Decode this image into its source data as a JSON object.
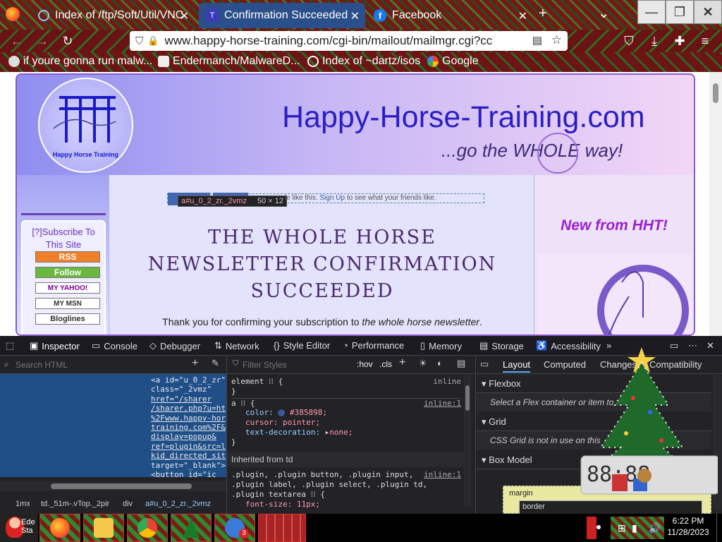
{
  "browser": {
    "tabs": [
      {
        "label": "Index of /ftp/Soft/Util/VNC",
        "close": "✕"
      },
      {
        "label": "Confirmation Succeeded",
        "close": "✕"
      },
      {
        "label": "Facebook",
        "close": "✕"
      }
    ],
    "new_tab": "+",
    "tab_list": "⌄",
    "window": {
      "minimize": "—",
      "restore": "❐",
      "close": "✕"
    },
    "url": "www.happy-horse-training.com/cgi-bin/mailout/mailmgr.cgi?cc",
    "bookmarks": [
      {
        "label": "if youre gonna run malw..."
      },
      {
        "label": "Endermanch/MalwareD..."
      },
      {
        "label": "Index of ~dartz/isos"
      },
      {
        "label": "Google"
      }
    ]
  },
  "site": {
    "title": "Happy-Horse-Training.com",
    "tagline": "...go the WHOLE way!",
    "logo_text": "Happy Horse Training",
    "subscribe_label": "[?]Subscribe To This Site",
    "feeds": [
      "RSS",
      "Follow",
      "MY YAHOO!",
      "MY MSN",
      "Bloglines"
    ],
    "fb_tooltip": {
      "selector": "a#u_0_2_zr._2vmz",
      "size": "50 × 12"
    },
    "fb_text": "le like this.",
    "fb_signup": "Sign Up",
    "fb_tail": "to see what your friends like.",
    "heading": "THE WHOLE HORSE NEWSLETTER CONFIRMATION SUCCEEDED",
    "body_prefix": "Thank you for confirming your subscription to ",
    "body_em": "the whole horse newsletter",
    "body_suffix": ".",
    "right_heading": "New from HHT!"
  },
  "devtools": {
    "tabs": [
      "Inspector",
      "Console",
      "Debugger",
      "Network",
      "Style Editor",
      "Performance",
      "Memory",
      "Storage",
      "Accessibility"
    ],
    "search_placeholder": "Search HTML",
    "html_lines": [
      "<a id=\"u_0_2_zr\"",
      "class=\"_2vmz\"",
      "href=\"/sharer",
      "/sharer.php?u=ht",
      "%2Fwww.happy-hor",
      "training.com%2F&",
      "display=popup&",
      "ref=plugin&src=l",
      "kid_directed_sit",
      "target=\"_blank\">",
      "<button id=\"ic"
    ],
    "breadcrumbs": [
      "1mx",
      "td._51m-.vTop._2pir",
      "div",
      "a#u_0_2_zr._2vmz"
    ],
    "filter_placeholder": "Filter Styles",
    "hov": ":hov",
    "cls": ".cls",
    "rules": {
      "element_selector": "element",
      "element_src": "inline",
      "a_selector": "a",
      "a_src": "inline:1",
      "decl_color_name": "color:",
      "decl_color_value": "#385898;",
      "decl_cursor": "cursor: pointer;",
      "decl_td_name": "text-decoration:",
      "decl_td_value": "none;",
      "inherited": "Inherited from td",
      "plugin_selector": ".plugin, .plugin button, .plugin input, .plugin label, .plugin select, .plugin td, .plugin textarea",
      "plugin_src": "inline:1",
      "plugin_decl": "font-size: 11px;"
    },
    "layout_tabs": [
      "Layout",
      "Computed",
      "Changes",
      "Compatibility"
    ],
    "sections": [
      {
        "title": "Flexbox",
        "body": "Select a Flex container or item to"
      },
      {
        "title": "Grid",
        "body": "CSS Grid is not in use on this"
      },
      {
        "title": "Box Model",
        "body": ""
      }
    ],
    "box_margin": "margin",
    "box_border": "border",
    "box_badge": "3"
  },
  "taskbar": {
    "time": "6:22 PM",
    "date": "11/28/2023",
    "badge": "3",
    "start_text": "Ede Sta"
  },
  "colors": {
    "accent": "#385898",
    "site_title": "#2a1fc4",
    "heading": "#4b2a6e",
    "new_from": "#9a1fd0"
  }
}
